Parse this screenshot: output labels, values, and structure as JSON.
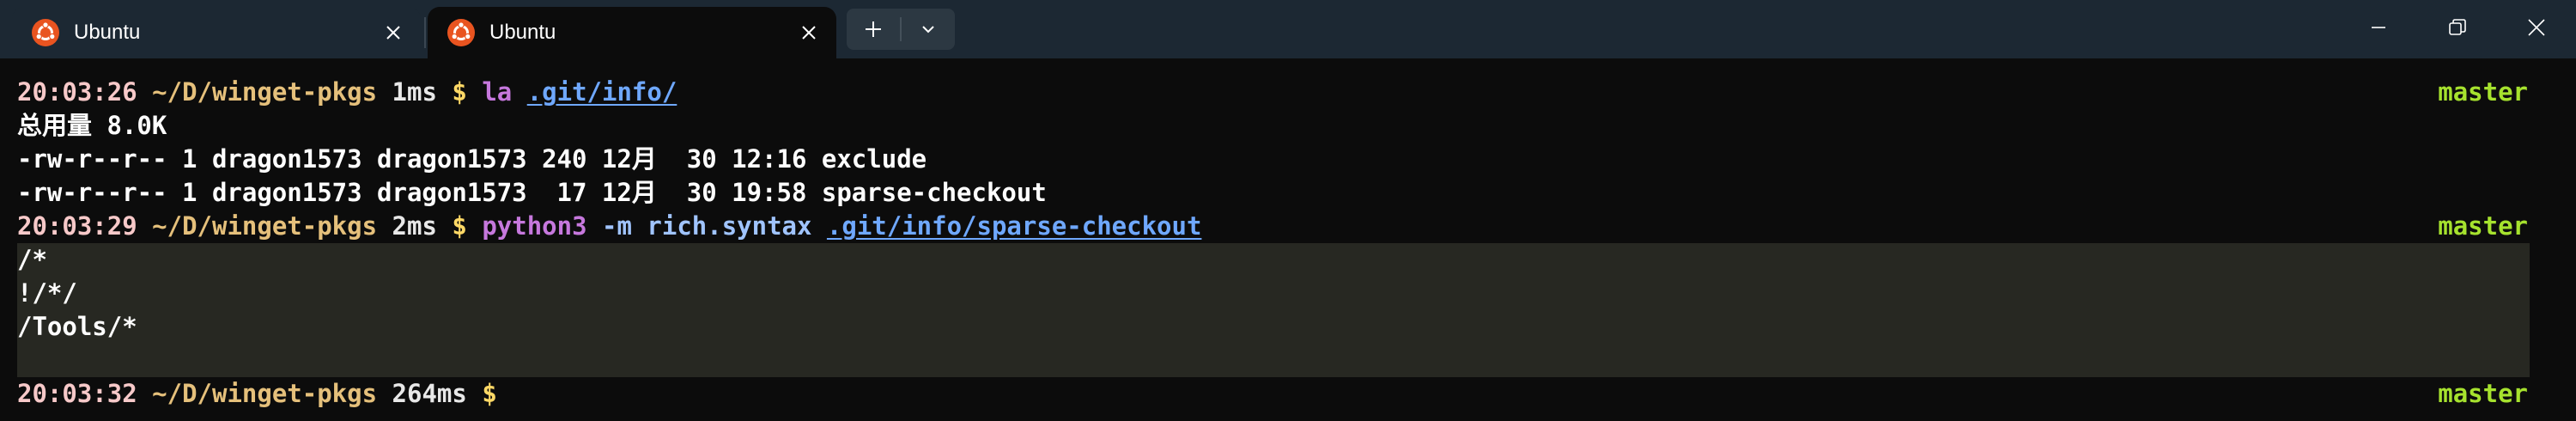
{
  "tabs": [
    {
      "label": "Ubuntu",
      "active": false
    },
    {
      "label": "Ubuntu",
      "active": true
    }
  ],
  "colors": {
    "accent_ubuntu": "#e95420",
    "prompt_time": "#f7c9c9",
    "prompt_path": "#e5c07b",
    "git_branch": "#a6e22e",
    "command": "#c678dd",
    "link": "#6fa8ff",
    "syntax_bg": "#272822"
  },
  "terminal": {
    "prompt1": {
      "time": "20:03:26",
      "path": "~/D/winget-pkgs",
      "duration": "1ms",
      "symbol": "$",
      "command": "la",
      "arg": ".git/info/",
      "branch": "master"
    },
    "output1": [
      "总用量 8.0K",
      "-rw-r--r-- 1 dragon1573 dragon1573 240 12月  30 12:16 exclude",
      "-rw-r--r-- 1 dragon1573 dragon1573  17 12月  30 19:58 sparse-checkout"
    ],
    "prompt2": {
      "time": "20:03:29",
      "path": "~/D/winget-pkgs",
      "duration": "2ms",
      "symbol": "$",
      "command": "python3",
      "flags": "-m rich.syntax",
      "arg": ".git/info/sparse-checkout",
      "branch": "master"
    },
    "syntax_lines": [
      "/*",
      "!/*/",
      "/Tools/*"
    ],
    "prompt3": {
      "time": "20:03:32",
      "path": "~/D/winget-pkgs",
      "duration": "264ms",
      "symbol": "$",
      "branch": "master"
    }
  }
}
